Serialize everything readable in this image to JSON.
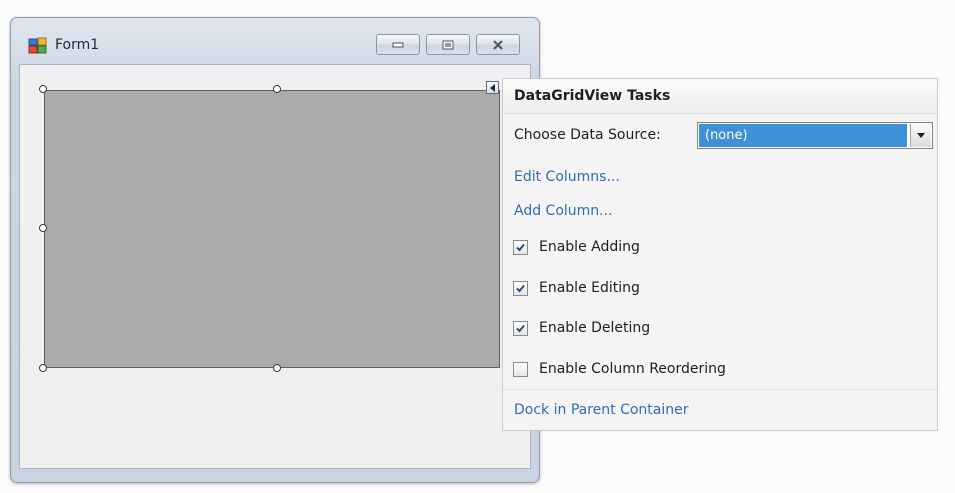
{
  "window": {
    "title": "Form1",
    "icon": "form-app-icon",
    "buttons": [
      "minimize-icon",
      "maximize-icon",
      "close-icon"
    ]
  },
  "datagrid": {
    "background": "#ababab"
  },
  "tasks": {
    "title": "DataGridView Tasks",
    "data_source_label": "Choose Data Source:",
    "data_source_value": "(none)",
    "edit_columns": "Edit Columns...",
    "add_column": "Add Column...",
    "checkboxes": [
      {
        "label": "Enable Adding",
        "checked": true
      },
      {
        "label": "Enable Editing",
        "checked": true
      },
      {
        "label": "Enable Deleting",
        "checked": true
      },
      {
        "label": "Enable Column Reordering",
        "checked": false
      }
    ],
    "dock": "Dock in Parent Container"
  },
  "colors": {
    "link": "#2e6eb5",
    "selection": "#3f8fd9"
  }
}
